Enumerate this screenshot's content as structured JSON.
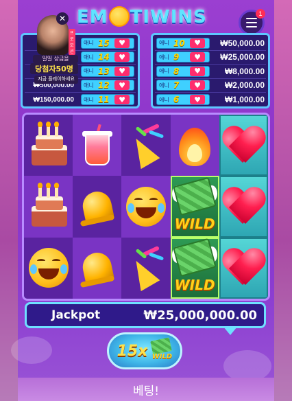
{
  "header": {
    "logo_text": "EMOTIWINS",
    "logo_left": "EM",
    "logo_right": "TIWINS",
    "menu_badge": "1",
    "menu_icon": "hamburger-icon"
  },
  "promo": {
    "badge": "프로모션",
    "line1": "일일 상금을",
    "line2": "당첨자50명",
    "line3": "지금 플레이하세요",
    "close_icon": "close-icon"
  },
  "paytable": {
    "left": [
      {
        "amount": "",
        "tag": "애니",
        "count": "15"
      },
      {
        "amount": "",
        "tag": "애니",
        "count": "14"
      },
      {
        "amount": "",
        "tag": "애니",
        "count": "13"
      },
      {
        "amount": "₩500,000.00",
        "tag": "애니",
        "count": "12"
      },
      {
        "amount": "₩150,000.00",
        "tag": "애니",
        "count": "11"
      }
    ],
    "right": [
      {
        "amount": "₩50,000.00",
        "tag": "애니",
        "count": "10"
      },
      {
        "amount": "₩25,000.00",
        "tag": "애니",
        "count": "9"
      },
      {
        "amount": "₩8,000.00",
        "tag": "애니",
        "count": "8"
      },
      {
        "amount": "₩2,000.00",
        "tag": "애니",
        "count": "7"
      },
      {
        "amount": "₩1,000.00",
        "tag": "애니",
        "count": "6"
      }
    ],
    "heart_icon": "heart-icon"
  },
  "reels": {
    "symbols": [
      [
        "cake-icon",
        "drink-icon",
        "party-popper-icon",
        "fire-icon",
        "heart-icon"
      ],
      [
        "cake-icon",
        "bell-icon",
        "laughing-emoji-icon",
        "wild-icon",
        "heart-icon"
      ],
      [
        "laughing-emoji-icon",
        "bell-icon",
        "party-popper-icon",
        "wild-icon",
        "heart-icon"
      ]
    ],
    "wild_label": "WILD"
  },
  "jackpot": {
    "label": "Jackpot",
    "value": "₩25,000,000.00"
  },
  "multiplier": {
    "value": "15x",
    "wild_label": "WILD"
  },
  "bottom": {
    "text": "베팅!"
  },
  "colors": {
    "background": "#8b35c9",
    "accent_cyan": "#6fe0ff",
    "heart_red": "#ff1f4f",
    "gold": "#ffd21a"
  }
}
